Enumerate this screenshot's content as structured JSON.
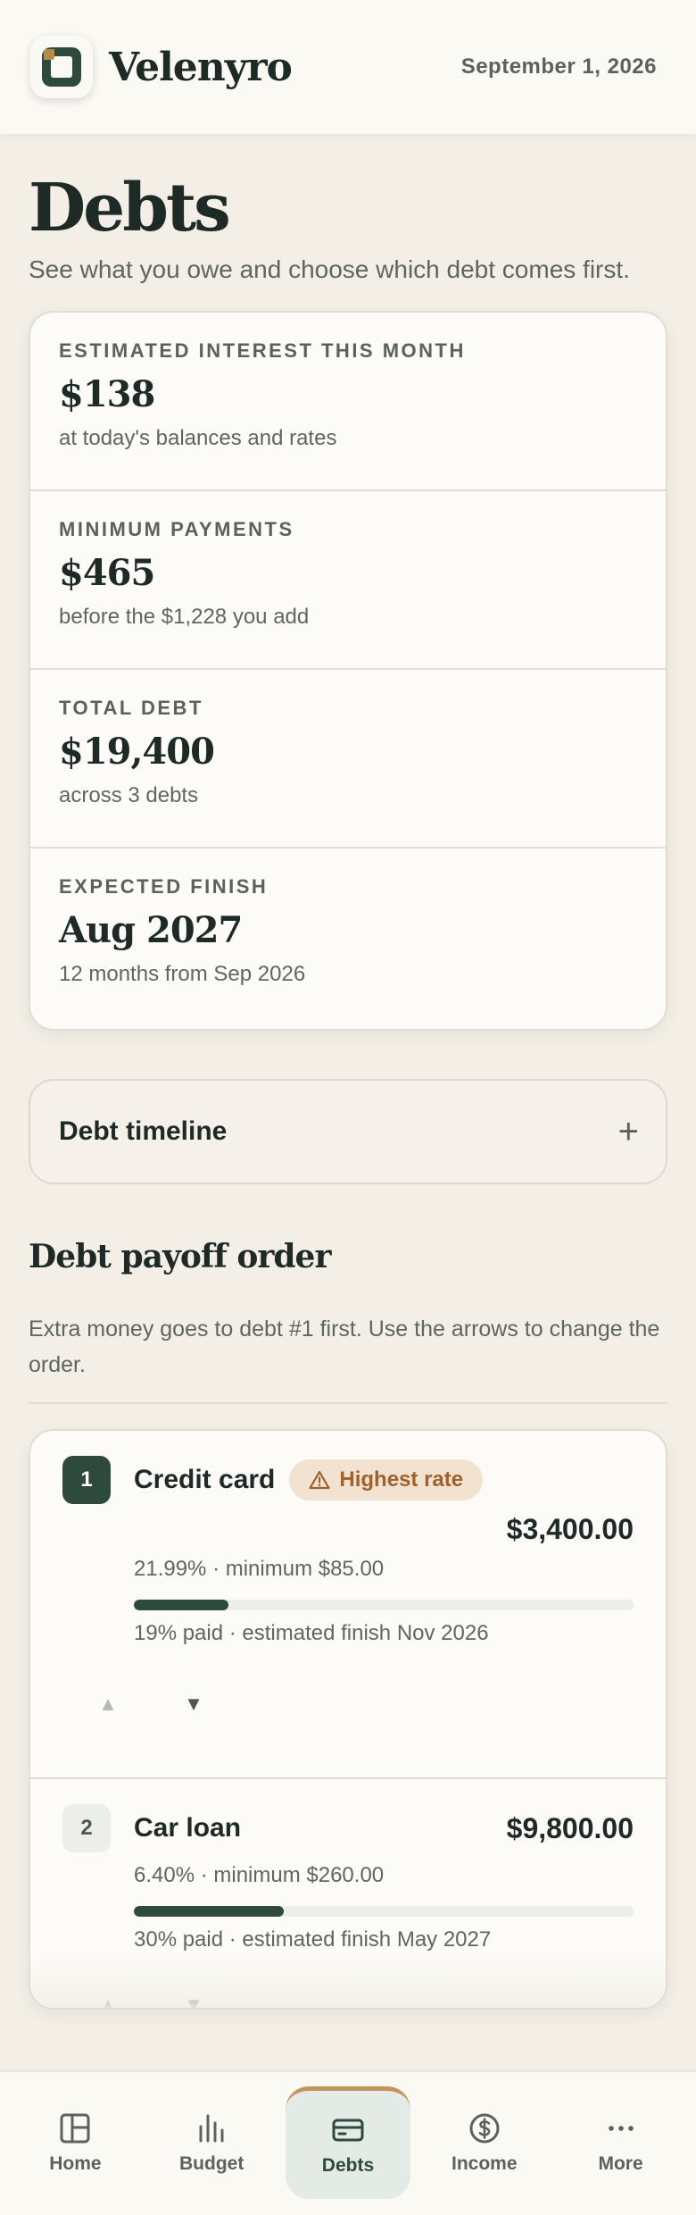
{
  "header": {
    "app_name": "Velenyro",
    "date": "September 1, 2026"
  },
  "page": {
    "title": "Debts",
    "subtitle": "See what you owe and choose which debt comes first."
  },
  "stats": [
    {
      "label": "ESTIMATED INTEREST THIS MONTH",
      "value": "$138",
      "note": "at today's balances and rates"
    },
    {
      "label": "MINIMUM PAYMENTS",
      "value": "$465",
      "note": "before the $1,228 you add"
    },
    {
      "label": "TOTAL DEBT",
      "value": "$19,400",
      "note": "across 3 debts"
    },
    {
      "label": "EXPECTED FINISH",
      "value": "Aug 2027",
      "note": "12 months from Sep 2026"
    }
  ],
  "timeline": {
    "label": "Debt timeline",
    "toggle": "+"
  },
  "payoff": {
    "title": "Debt payoff order",
    "subtitle": "Extra money goes to debt #1 first. Use the arrows to change the order.",
    "debts": [
      {
        "rank": "1",
        "name": "Credit card",
        "badge": "Highest rate",
        "amount": "$3,400.00",
        "meta": "21.99% · minimum $85.00",
        "paid_fraction": 0.19,
        "status": "19% paid · estimated finish Nov 2026",
        "up": "▲",
        "down": "▼"
      },
      {
        "rank": "2",
        "name": "Car loan",
        "amount": "$9,800.00",
        "meta": "6.40% · minimum $260.00",
        "paid_fraction": 0.3,
        "status": "30% paid · estimated finish May 2027",
        "up": "▲",
        "down": "▼"
      }
    ]
  },
  "nav": {
    "items": [
      {
        "label": "Home",
        "icon": "home-grid-icon"
      },
      {
        "label": "Budget",
        "icon": "bar-chart-icon"
      },
      {
        "label": "Debts",
        "icon": "credit-card-icon",
        "active": true
      },
      {
        "label": "Income",
        "icon": "dollar-coin-icon"
      },
      {
        "label": "More",
        "icon": "more-dots-icon"
      }
    ]
  },
  "colors": {
    "accent": "#2e4a3c",
    "warning_bg": "#f2e3d1",
    "warning_text": "#a0612a",
    "background": "#f3efe7"
  }
}
